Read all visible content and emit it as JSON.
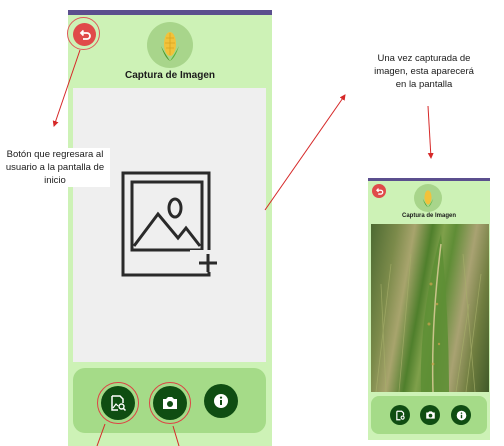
{
  "app": {
    "title": "Captura de Imagen",
    "accent_color": "#cdf2b6",
    "action_color": "#0f4d12",
    "back_color": "#e04a4a"
  },
  "main_screen": {
    "title": "Captura de Imagen",
    "back_icon": "undo-arrow-icon",
    "logo_icon": "corn-logo-icon",
    "placeholder_icon": "add-image-icon",
    "actions": [
      {
        "name": "gallery-button",
        "icon": "gallery-search-icon"
      },
      {
        "name": "camera-button",
        "icon": "camera-icon"
      },
      {
        "name": "info-button",
        "icon": "info-icon"
      }
    ]
  },
  "annotations": {
    "back_note": "Botón que regresara al usuario a la pantalla de inicio",
    "capture_note": "Una vez capturada de imagen, esta aparecerá en la pantalla"
  },
  "preview_screen": {
    "title": "Captura de Imagen"
  }
}
